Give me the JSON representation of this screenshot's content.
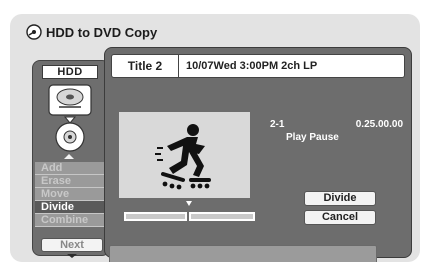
{
  "window": {
    "title": "HDD to DVD Copy",
    "title_icon": "disc-icon"
  },
  "side_panel": {
    "source_label": "HDD",
    "menu": [
      {
        "label": "Add",
        "active": false
      },
      {
        "label": "Erase",
        "active": false
      },
      {
        "label": "Move",
        "active": false
      },
      {
        "label": "Divide",
        "active": true
      },
      {
        "label": "Combine",
        "active": false
      }
    ],
    "next_label": "Next"
  },
  "title_info": {
    "name": "Title 2",
    "details": "10/07Wed  3:00PM  2ch LP"
  },
  "playback": {
    "chapter": "2-1",
    "timecode": "0.25.00.00",
    "status": "Play Pause"
  },
  "actions": {
    "divide_label": "Divide",
    "cancel_label": "Cancel"
  },
  "divide_point_fraction": 0.5,
  "colors": {
    "screen_bg": "#e3e3e3",
    "panel_bg": "#6d6d6d",
    "active_menu": "#5a5a5a"
  }
}
